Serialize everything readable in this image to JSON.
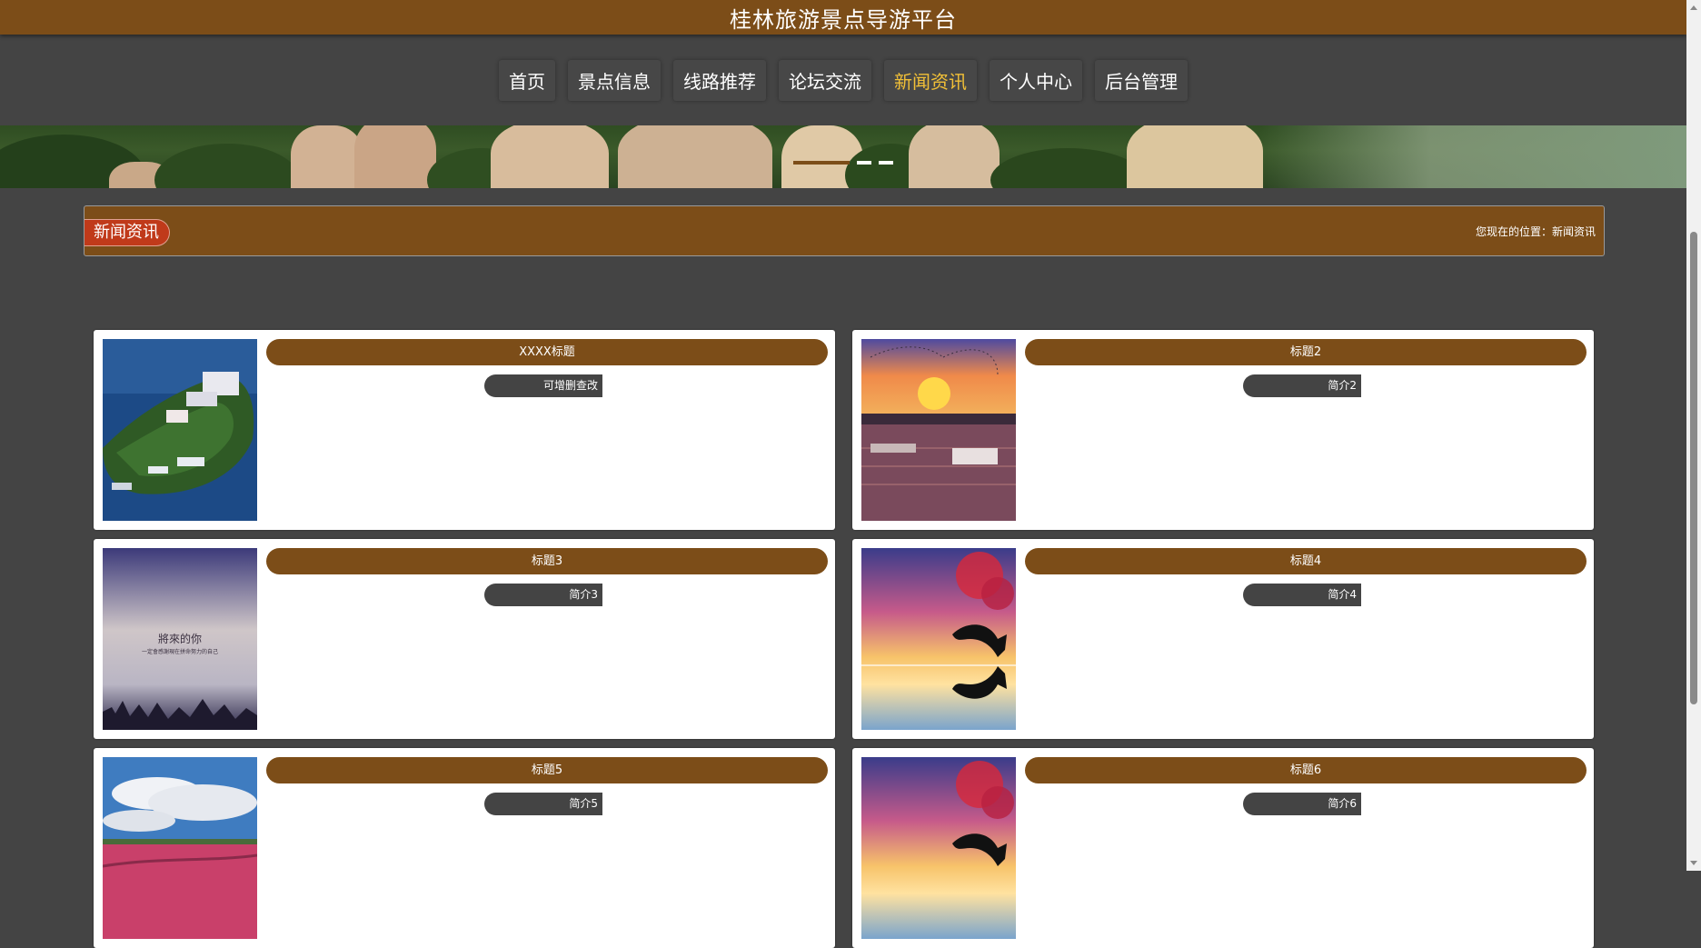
{
  "header": {
    "title": "桂林旅游景点导游平台"
  },
  "nav": {
    "items": [
      {
        "label": "首页",
        "active": false
      },
      {
        "label": "景点信息",
        "active": false
      },
      {
        "label": "线路推荐",
        "active": false
      },
      {
        "label": "论坛交流",
        "active": false
      },
      {
        "label": "新闻资讯",
        "active": true
      },
      {
        "label": "个人中心",
        "active": false
      },
      {
        "label": "后台管理",
        "active": false
      }
    ]
  },
  "banner": {
    "slide_count": 3,
    "active_slide": 1
  },
  "section": {
    "title": "新闻资讯",
    "breadcrumb": "您现在的位置：新闻资讯"
  },
  "news": [
    {
      "title": "XXXX标题",
      "summary": "可增删查改",
      "image": "island-resort-photo"
    },
    {
      "title": "标题2",
      "summary": "简介2",
      "image": "river-sunset-photo"
    },
    {
      "title": "标题3",
      "summary": "简介3",
      "image": "dusk-sky-text-photo"
    },
    {
      "title": "标题4",
      "summary": "简介4",
      "image": "dolphin-sunset-photo"
    },
    {
      "title": "标题5",
      "summary": "简介5",
      "image": "cloudy-field-photo"
    },
    {
      "title": "标题6",
      "summary": "简介6",
      "image": "dolphin-sunset-photo"
    }
  ],
  "photo_text": {
    "line1": "將來的你",
    "line2": "一定會感謝現在拼命努力的自己"
  },
  "colors": {
    "brand": "#7c4d18",
    "active_nav": "#f2c037",
    "section_tag": "#c03a1a",
    "background": "#444444"
  }
}
